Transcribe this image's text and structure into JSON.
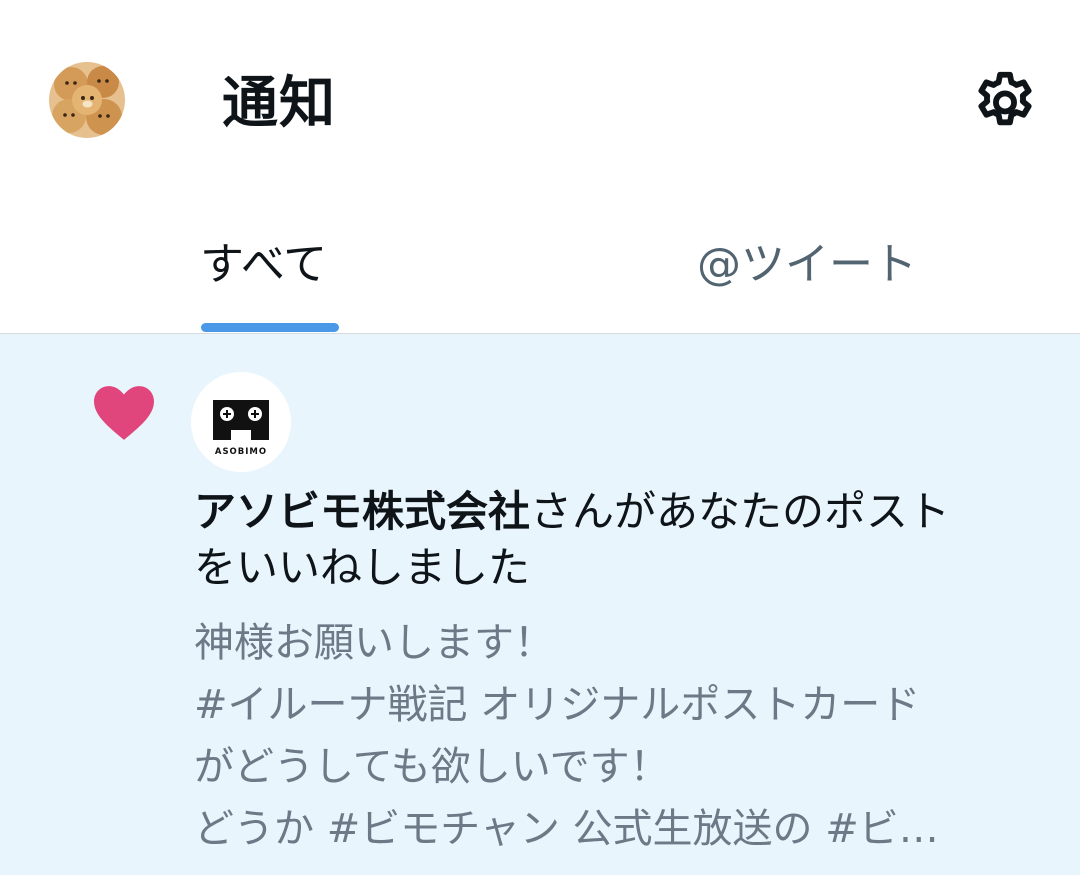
{
  "header": {
    "title": "通知",
    "avatar_icon": "user-avatar",
    "settings_icon": "gear-icon"
  },
  "tabs": [
    {
      "label": "すべて",
      "selected": true
    },
    {
      "label": "@ツイート",
      "selected": false
    }
  ],
  "notification": {
    "type_icon": "heart-icon",
    "avatar_text": "ASOBIMO",
    "user_name": "アソビモ株式会社",
    "action_line1": "さんがあなたのポスト",
    "action_line2": "をいいねしました",
    "preview_lines": [
      "神様お願いします！",
      "#イルーナ戦記 オリジナルポストカード",
      "がどうしても欲しいです！",
      "どうか #ビモチャン 公式生放送の #ビ…"
    ]
  },
  "colors": {
    "accent": "#4a99e9",
    "like": "#e0457b",
    "highlight_bg": "#e8f5fd",
    "secondary_text": "#6b7a86"
  }
}
